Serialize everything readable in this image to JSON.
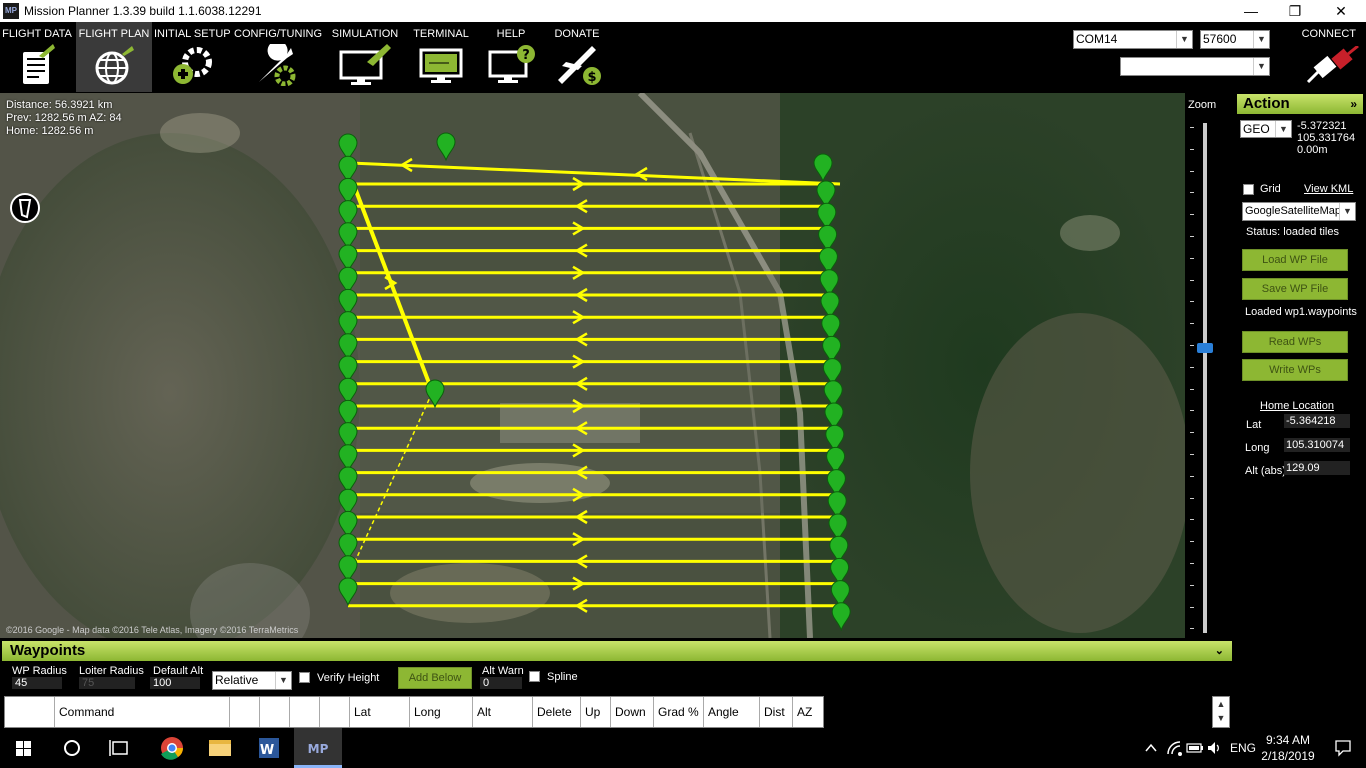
{
  "window": {
    "title": "Mission Planner 1.3.39 build 1.1.6038.12291",
    "app_icon": "MP",
    "minimize": "—",
    "maximize": "❐",
    "close": "✕"
  },
  "menu": {
    "items": [
      {
        "label": "FLIGHT DATA",
        "icon": "clipboard-icon"
      },
      {
        "label": "FLIGHT PLAN",
        "icon": "globe-icon"
      },
      {
        "label": "INITIAL SETUP",
        "icon": "gear-plus-icon"
      },
      {
        "label": "CONFIG/TUNING",
        "icon": "wrench-icon"
      },
      {
        "label": "SIMULATION",
        "icon": "monitor-plane-icon"
      },
      {
        "label": "TERMINAL",
        "icon": "monitor-terminal-icon"
      },
      {
        "label": "HELP",
        "icon": "monitor-help-icon"
      },
      {
        "label": "DONATE",
        "icon": "plane-dollar-icon"
      }
    ],
    "port": "COM14",
    "baud": "57600",
    "connect_label": "CONNECT"
  },
  "map": {
    "distance": "Distance: 56.3921 km",
    "prev": "Prev: 1282.56 m AZ: 84",
    "home": "Home: 1282.56 m",
    "copyright": "©2016 Google - Map data ©2016 Tele Atlas, Imagery ©2016 TerraMetrics"
  },
  "zoom": {
    "label": "Zoom",
    "level": 0.56
  },
  "action": {
    "header": "Action",
    "coord_mode": "GEO",
    "lat": "-5.372321",
    "lng": "105.331764",
    "alt": "0.00m",
    "grid_label": "Grid",
    "view_kml": "View KML",
    "map_type": "GoogleSatelliteMap",
    "status": "Status: loaded tiles",
    "load_wp": "Load WP File",
    "save_wp": "Save WP File",
    "loaded_msg": "Loaded wp1.waypoints",
    "read_wps": "Read WPs",
    "write_wps": "Write WPs",
    "home_location": "Home Location",
    "home_lat_label": "Lat",
    "home_lat": "-5.364218",
    "home_long_label": "Long",
    "home_long": "105.310074",
    "home_alt_label": "Alt (abs)",
    "home_alt": "129.09"
  },
  "waypoints": {
    "header": "Waypoints",
    "wp_radius_label": "WP Radius",
    "wp_radius": "45",
    "loiter_radius_label": "Loiter Radius",
    "loiter_radius": "75",
    "default_alt_label": "Default Alt",
    "default_alt": "100",
    "alt_mode": "Relative",
    "verify_height": "Verify Height",
    "add_below": "Add Below",
    "alt_warn_label": "Alt Warn",
    "alt_warn": "0",
    "spline": "Spline",
    "columns": [
      "Command",
      "Lat",
      "Long",
      "Alt",
      "Delete",
      "Up",
      "Down",
      "Grad %",
      "Angle",
      "Dist",
      "AZ"
    ]
  },
  "taskbar": {
    "language": "ENG",
    "time": "9:34 AM",
    "date": "2/18/2019"
  },
  "colors": {
    "accent_green": "#8db733",
    "path_yellow": "#ffff00",
    "marker_green": "#22b222"
  }
}
